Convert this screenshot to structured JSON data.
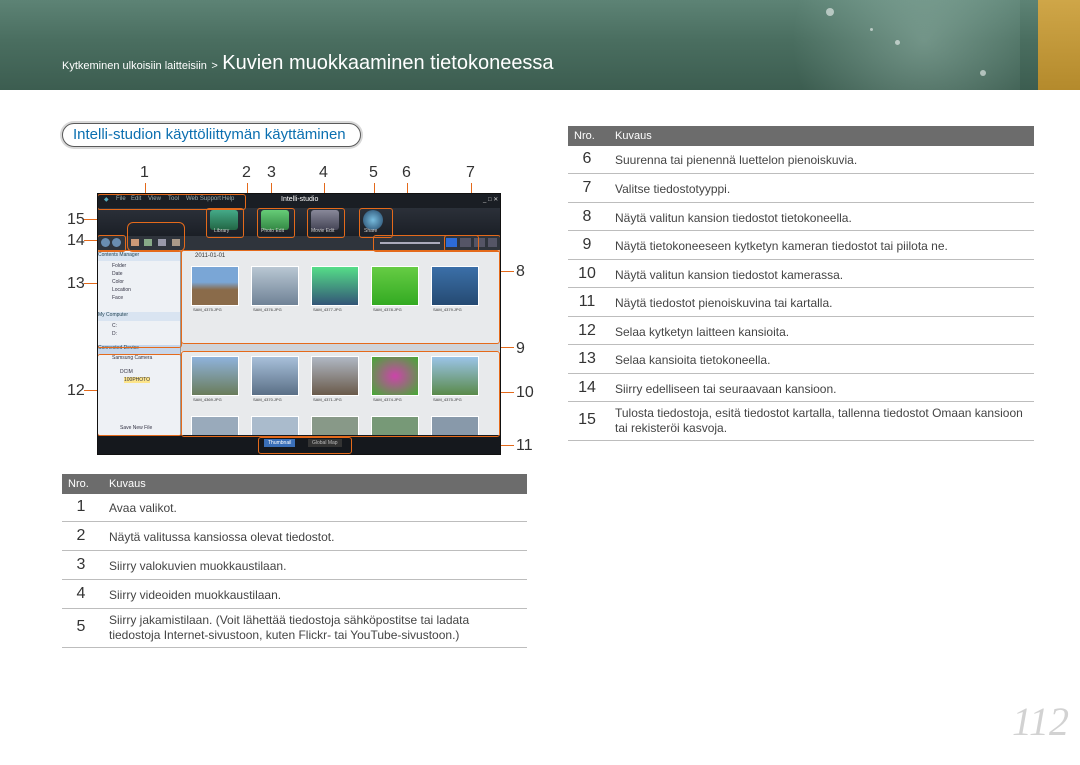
{
  "breadcrumb": {
    "parent": "Kytkeminen ulkoisiin laitteisiin",
    "separator": ">",
    "current": "Kuvien muokkaaminen tietokoneessa"
  },
  "section_title": {
    "bold": "Intelli-studion",
    "rest": "käyttöliittymän käyttäminen"
  },
  "screenshot": {
    "menu": [
      "File",
      "Edit",
      "View",
      "Tool",
      "Web Support",
      "Help"
    ],
    "app_name": "Intelli-studio",
    "toolbar": [
      "Library",
      "Photo Edit",
      "Movie Edit",
      "Share"
    ],
    "date": "2011-01-01",
    "sidebar": {
      "contents_manager": "Contents Manager",
      "items": [
        "Folder",
        "Date",
        "Color",
        "Location",
        "Face"
      ],
      "my_computer": "My Computer",
      "drives": [
        "C:",
        "D:"
      ],
      "connected_device": "Connected Device",
      "device": "Samsung Camera",
      "folders": [
        "DCIM",
        "100PHOTO"
      ],
      "save_new_file": "Save New File"
    },
    "files_top": [
      "SAM_4375.JPG",
      "SAM_4376.JPG",
      "SAM_4377.JPG",
      "SAM_4378.JPG",
      "SAM_4379.JPG"
    ],
    "files_bottom": [
      "SAM_4369.JPG",
      "SAM_4370.JPG",
      "SAM_4371.JPG",
      "SAM_4374.JPG",
      "SAM_4375.JPG"
    ],
    "bottom_tabs": [
      "Thumbnail",
      "Global Map"
    ],
    "callouts_top": [
      "1",
      "2",
      "3",
      "4",
      "5",
      "6",
      "7"
    ],
    "callouts_left": [
      "15",
      "14",
      "13",
      "12"
    ],
    "callouts_right": [
      "8",
      "9",
      "10",
      "11"
    ]
  },
  "table_left": {
    "header": {
      "col1": "Nro.",
      "col2": "Kuvaus"
    },
    "rows": [
      {
        "n": "1",
        "text": "Avaa valikot."
      },
      {
        "n": "2",
        "text": "Näytä valitussa kansiossa olevat tiedostot."
      },
      {
        "n": "3",
        "text": "Siirry valokuvien muokkaustilaan."
      },
      {
        "n": "4",
        "text": "Siirry videoiden muokkaustilaan."
      },
      {
        "n": "5",
        "text": "Siirry jakamistilaan. (Voit lähettää tiedostoja sähköpostitse tai ladata tiedostoja Internet-sivustoon, kuten Flickr- tai YouTube-sivustoon.)"
      }
    ]
  },
  "table_right": {
    "header": {
      "col1": "Nro.",
      "col2": "Kuvaus"
    },
    "rows": [
      {
        "n": "6",
        "text": "Suurenna tai pienennä luettelon pienoiskuvia."
      },
      {
        "n": "7",
        "text": "Valitse tiedostotyyppi."
      },
      {
        "n": "8",
        "text": "Näytä valitun kansion tiedostot tietokoneella."
      },
      {
        "n": "9",
        "text": "Näytä tietokoneeseen kytketyn kameran tiedostot tai piilota ne."
      },
      {
        "n": "10",
        "text": "Näytä valitun kansion tiedostot kamerassa."
      },
      {
        "n": "11",
        "text": "Näytä tiedostot pienoiskuvina tai kartalla."
      },
      {
        "n": "12",
        "text": "Selaa kytketyn laitteen kansioita."
      },
      {
        "n": "13",
        "text": "Selaa kansioita tietokoneella."
      },
      {
        "n": "14",
        "text": "Siirry edelliseen tai seuraavaan kansioon."
      },
      {
        "n": "15",
        "text": "Tulosta tiedostoja, esitä tiedostot kartalla, tallenna tiedostot Omaan kansioon tai rekisteröi kasvoja."
      }
    ]
  },
  "page_number": "112",
  "colors": {
    "header": "#4a6e60",
    "accent_gold": "#c39a3a",
    "callout": "#e46a1b",
    "table_header": "#6c6c6c",
    "link_blue": "#0b6fb0"
  }
}
